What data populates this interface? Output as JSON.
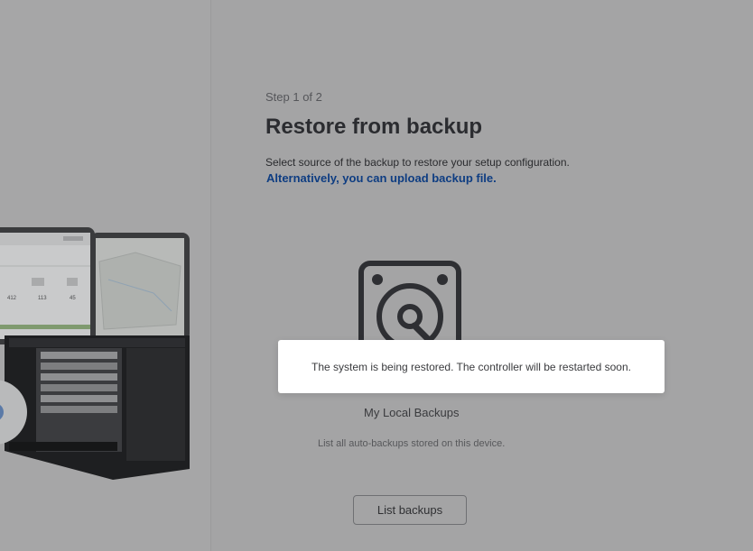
{
  "wizard": {
    "step": "Step 1 of 2",
    "title": "Restore from backup",
    "subtitle": "Select source of the backup to restore your setup configuration.",
    "upload_link": "Alternatively, you can upload backup file."
  },
  "source": {
    "icon": "hard-drive-icon",
    "label": "My Local Backups",
    "description": "List all auto-backups stored on this device.",
    "button_label": "List backups"
  },
  "toast": {
    "message": "The system is being restored. The controller will be restarted soon."
  },
  "hero_stats": {
    "values": [
      "412",
      "113",
      "45"
    ]
  },
  "colors": {
    "link": "#0e3d82",
    "overlay_bg": "#a4a4a5",
    "toast_bg": "#ffffff"
  }
}
